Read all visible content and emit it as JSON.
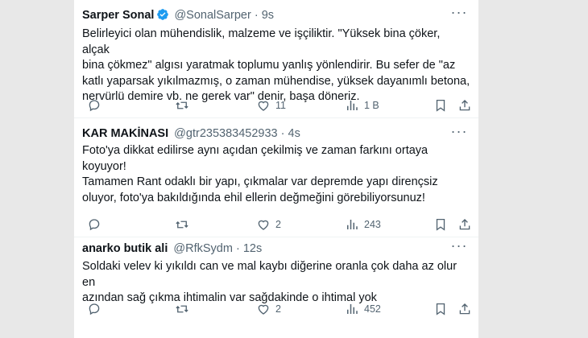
{
  "tweets": [
    {
      "name": "Sarper Sonal",
      "verified": true,
      "handle": "@SonalSarper",
      "time": "9s",
      "lines": [
        "Belirleyici olan mühendislik, malzeme ve işçiliktir. \"Yüksek bina çöker, alçak",
        "bina çökmez\" algısı yaratmak toplumu yanlış yönlendirir. Bu sefer de \"az",
        "katlı yaparsak yıkılmazmış, o zaman mühendise, yüksek dayanımlı betona,",
        "nervürlü demire vb. ne gerek var\" denir, başa döneriz."
      ],
      "replies": "",
      "retweets": "",
      "likes": "11",
      "views": "1 B"
    },
    {
      "name": "KAR MAKİNASI",
      "verified": false,
      "handle": "@gtr235383452933",
      "time": "4s",
      "lines": [
        "Foto'ya dikkat edilirse aynı açıdan çekilmiş ve zaman farkını ortaya",
        "koyuyor!",
        "Tamamen Rant odaklı bir yapı, çıkmalar var depremde yapı dirençsiz",
        "oluyor, foto'ya bakıldığında ehil ellerin değmeğini görebiliyorsunuz!"
      ],
      "replies": "",
      "retweets": "",
      "likes": "2",
      "views": "243"
    },
    {
      "name": "anarko butik ali",
      "verified": false,
      "handle": "@RfkSydm",
      "time": "12s",
      "lines": [
        "Soldaki velev ki yıkıldı can ve mal kaybı diğerine oranla çok daha az olur en",
        "azından sağ çıkma ihtimalin var sağdakinde o ihtimal yok"
      ],
      "replies": "",
      "retweets": "",
      "likes": "2",
      "views": "452"
    }
  ],
  "separator": "·",
  "icons": {
    "reply": "reply-icon",
    "retweet": "retweet-icon",
    "like": "heart-icon",
    "views": "views-icon",
    "bookmark": "bookmark-icon",
    "share": "share-icon",
    "more": "more-icon",
    "verified": "verified-badge-icon"
  },
  "colors": {
    "text": "#0f1419",
    "secondary": "#536471",
    "verified": "#1d9bf0"
  }
}
